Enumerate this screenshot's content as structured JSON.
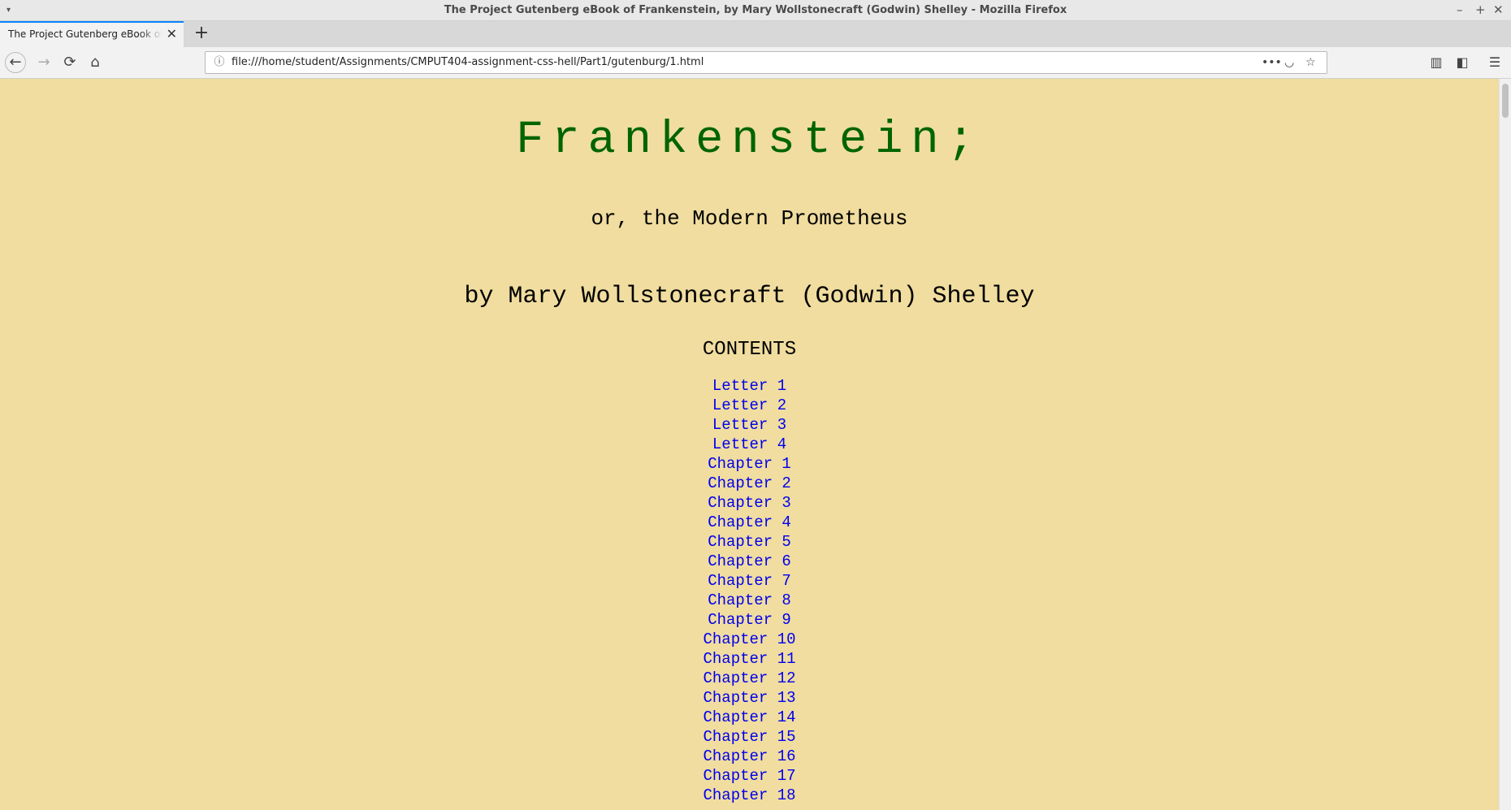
{
  "window": {
    "title": "The Project Gutenberg eBook of Frankenstein, by Mary Wollstonecraft (Godwin) Shelley - Mozilla Firefox",
    "minimize_glyph": "–",
    "maximize_glyph": "+",
    "close_glyph": "✕",
    "menu_glyph": "▾"
  },
  "tabs": [
    {
      "label": "The Project Gutenberg eBook of Frankenstein",
      "close_glyph": "✕"
    }
  ],
  "newtab_glyph": "+",
  "nav": {
    "back_icon": "←",
    "forward_icon": "→",
    "reload_icon": "⟳",
    "home_icon": "⌂",
    "url": "file:///home/student/Assignments/CMPUT404-assignment-css-hell/Part1/gutenburg/1.html",
    "info_icon": "ⓘ",
    "more_icon": "•••",
    "pocket_icon": "◡",
    "bookmark_icon": "☆",
    "library_icon": "▥",
    "sidebar_icon": "◧",
    "menu_icon": "☰"
  },
  "page": {
    "title": "Frankenstein;",
    "subtitle": "or, the Modern Prometheus",
    "author": "by Mary Wollstonecraft (Godwin) Shelley",
    "contents_heading": "CONTENTS",
    "toc": [
      "Letter 1",
      "Letter 2",
      "Letter 3",
      "Letter 4",
      "Chapter 1",
      "Chapter 2",
      "Chapter 3",
      "Chapter 4",
      "Chapter 5",
      "Chapter 6",
      "Chapter 7",
      "Chapter 8",
      "Chapter 9",
      "Chapter 10",
      "Chapter 11",
      "Chapter 12",
      "Chapter 13",
      "Chapter 14",
      "Chapter 15",
      "Chapter 16",
      "Chapter 17",
      "Chapter 18"
    ],
    "colors": {
      "background": "#f0dd9f",
      "title": "#006400",
      "link": "#0000ee"
    }
  }
}
